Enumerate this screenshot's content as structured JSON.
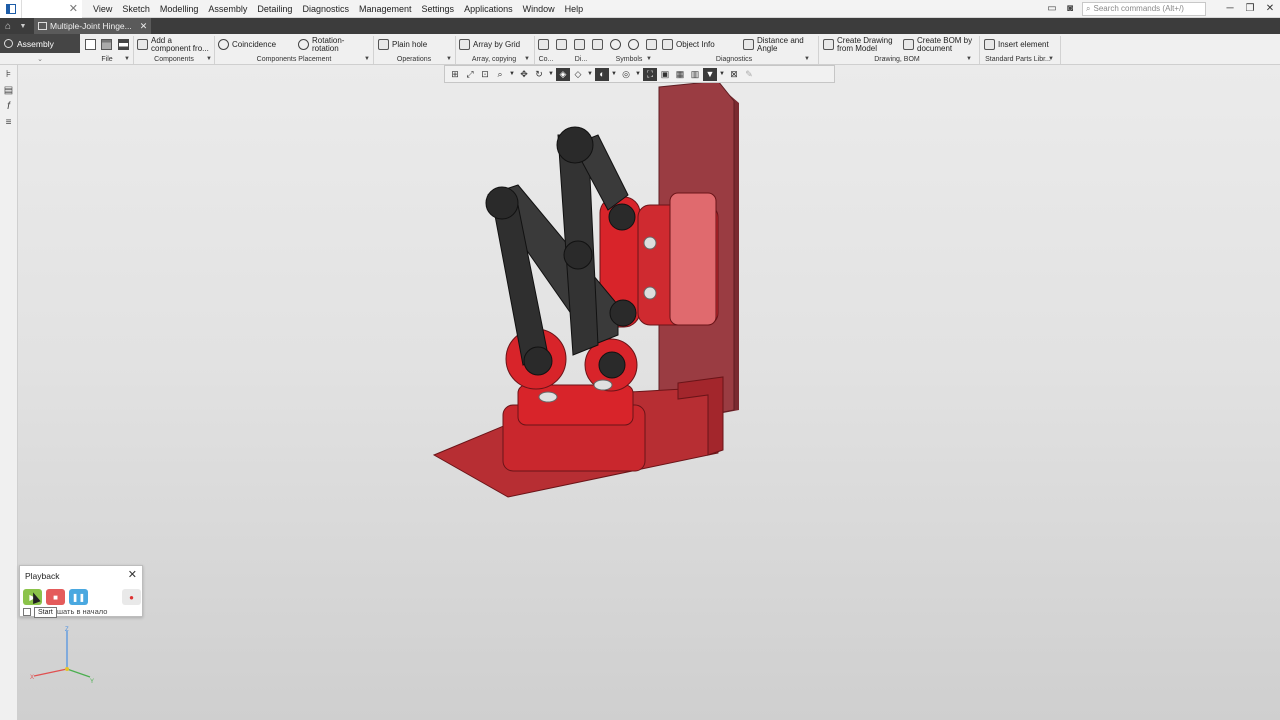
{
  "menu": {
    "items": [
      "View",
      "Sketch",
      "Modelling",
      "Assembly",
      "Detailing",
      "Diagnostics",
      "Management",
      "Settings",
      "Applications",
      "Window",
      "Help"
    ],
    "search_placeholder": "Search commands (Alt+/)"
  },
  "tab": {
    "doc_title": "Multiple-Joint Hinge..."
  },
  "ribbon": {
    "mode": "Assembly",
    "buttons": {
      "add_component": "Add a component fro...",
      "coincidence": "Coincidence",
      "rotation": "Rotation-rotation",
      "plain_hole": "Plain hole",
      "array_grid": "Array by Grid",
      "object_info": "Object Info",
      "distance_angle": "Distance and Angle",
      "create_drawing": "Create Drawing from Model",
      "create_bom": "Create BOM by document",
      "insert_element": "Insert element"
    },
    "groups": {
      "file": "File",
      "components": "Components",
      "placement": "Components Placement",
      "operations": "Operations",
      "array": "Array, copying",
      "co": "Co...",
      "di": "Di...",
      "symbols": "Symbols",
      "diagnostics": "Diagnostics",
      "drawing_bom": "Drawing, BOM",
      "std_parts": "Standard Parts Libr..."
    }
  },
  "playback": {
    "title": "Playback",
    "checkbox_label": "шать в начало",
    "tooltip": "Start"
  },
  "triad": {
    "x": "X",
    "y": "Y",
    "z": "Z"
  },
  "colors": {
    "part_red": "#d8242a",
    "part_dark": "#3a3a3a",
    "accent": "#1e5da8"
  }
}
